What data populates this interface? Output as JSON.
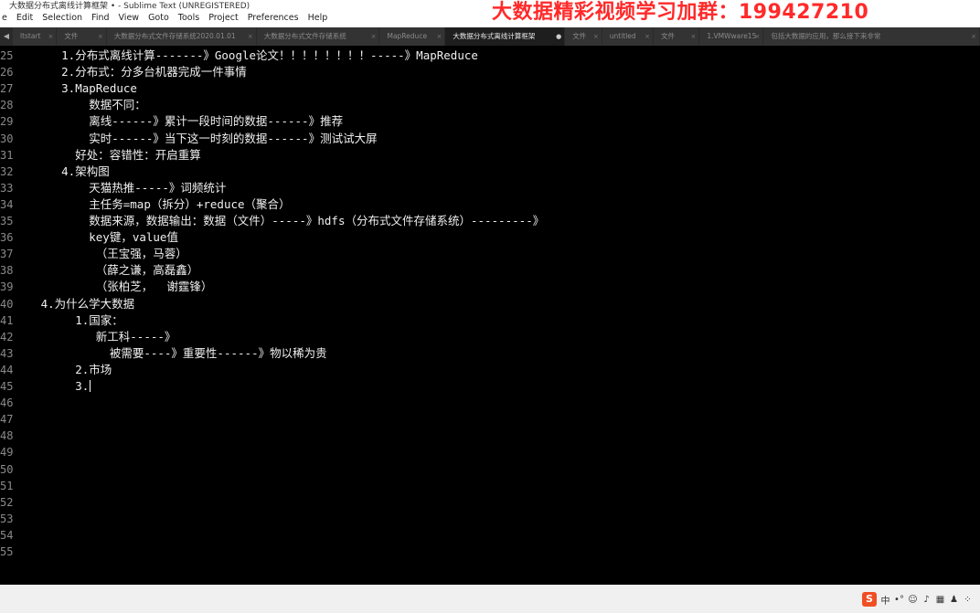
{
  "window": {
    "title": "大数据分布式离线计算框架 • - Sublime Text (UNREGISTERED)"
  },
  "menu": [
    "e",
    "Edit",
    "Selection",
    "Find",
    "View",
    "Goto",
    "Tools",
    "Project",
    "Preferences",
    "Help"
  ],
  "watermark": "大数据精彩视频学习加群：199427210",
  "tabs": [
    {
      "label": "ltstart",
      "active": false
    },
    {
      "label": "文件",
      "active": false
    },
    {
      "label": "大数据分布式文件存储系统2020.01.01",
      "active": false
    },
    {
      "label": "大数据分布式文件存储系统",
      "active": false
    },
    {
      "label": "MapReduce",
      "active": false
    },
    {
      "label": "大数据分布式离线计算框架",
      "active": true
    },
    {
      "label": "文件",
      "active": false
    },
    {
      "label": "untitled",
      "active": false
    },
    {
      "label": "文件",
      "active": false
    },
    {
      "label": "1.VMWware15",
      "active": false
    },
    {
      "label": "包括大数据的应用，那么接下来非常",
      "active": false
    }
  ],
  "editor": {
    "lines": [
      {
        "num": "25",
        "text": "      1.分布式离线计算-------》Google论文！！！！！！！！-----》MapReduce"
      },
      {
        "num": "26",
        "text": "      2.分布式：分多台机器完成一件事情"
      },
      {
        "num": "27",
        "text": "      3.MapReduce"
      },
      {
        "num": "28",
        "text": "          数据不同："
      },
      {
        "num": "29",
        "text": "          离线------》累计一段时间的数据------》推荐"
      },
      {
        "num": "30",
        "text": "          实时------》当下这一时刻的数据------》测试试大屏"
      },
      {
        "num": "31",
        "text": "        好处：容错性：开启重算"
      },
      {
        "num": "32",
        "text": "      4.架构图"
      },
      {
        "num": "33",
        "text": "          天猫热推-----》词频统计"
      },
      {
        "num": "34",
        "text": "          主任务=map（拆分）+reduce（聚合）"
      },
      {
        "num": "35",
        "text": "          数据来源，数据输出：数据（文件）-----》hdfs（分布式文件存储系统）---------》"
      },
      {
        "num": "36",
        "text": "          key键，value值"
      },
      {
        "num": "37",
        "text": "           （王宝强，马蓉）"
      },
      {
        "num": "38",
        "text": "           （薛之谦，高磊鑫）"
      },
      {
        "num": "39",
        "text": "           （张柏芝，  谢霆锋）"
      },
      {
        "num": "40",
        "text": "   4.为什么学大数据"
      },
      {
        "num": "41",
        "text": "        1.国家："
      },
      {
        "num": "42",
        "text": "           新工科-----》"
      },
      {
        "num": "43",
        "text": "             被需要----》重要性------》物以稀为贵"
      },
      {
        "num": "44",
        "text": "        2.市场"
      },
      {
        "num": "45",
        "text": "        3."
      },
      {
        "num": "46",
        "text": ""
      },
      {
        "num": "47",
        "text": ""
      },
      {
        "num": "48",
        "text": ""
      },
      {
        "num": "49",
        "text": ""
      },
      {
        "num": "50",
        "text": ""
      },
      {
        "num": "51",
        "text": ""
      },
      {
        "num": "52",
        "text": ""
      },
      {
        "num": "53",
        "text": ""
      },
      {
        "num": "54",
        "text": ""
      },
      {
        "num": "55",
        "text": ""
      }
    ]
  },
  "tray": {
    "ime_logo": "S",
    "ime_lang": "中"
  },
  "colors": {
    "editor_bg": "#000000",
    "watermark": "#ff2a2a",
    "tab_active": "#1e1e1e"
  }
}
